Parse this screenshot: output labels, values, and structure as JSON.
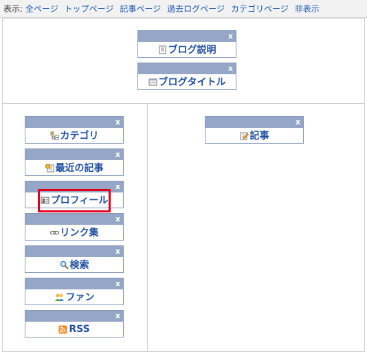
{
  "topbar": {
    "label": "表示:",
    "links": [
      "全ページ",
      "トップページ",
      "記事ページ",
      "過去ログページ",
      "カテゴリページ",
      "非表示"
    ]
  },
  "close_label": "x",
  "widgets": {
    "blog_description": {
      "label": "ブログ説明",
      "icon": "document-icon"
    },
    "blog_title": {
      "label": "ブログタイトル",
      "icon": "window-icon"
    },
    "category": {
      "label": "カテゴリ",
      "icon": "tree-icon"
    },
    "recent_articles": {
      "label": "最近の記事",
      "icon": "recent-articles-icon"
    },
    "profile": {
      "label": "プロフィール",
      "icon": "profile-card-icon"
    },
    "links": {
      "label": "リンク集",
      "icon": "chain-link-icon"
    },
    "search": {
      "label": "検索",
      "icon": "magnifier-icon"
    },
    "fan": {
      "label": "ファン",
      "icon": "people-icon"
    },
    "rss": {
      "label": "RSS",
      "icon": "rss-feed-icon"
    },
    "article": {
      "label": "記事",
      "icon": "pencil-note-icon"
    }
  },
  "colors": {
    "widget_header": "#96a6c6",
    "widget_border": "#8597bb",
    "widget_text": "#1f4fa0",
    "link": "#1a56b0",
    "highlight": "#e0001a"
  }
}
